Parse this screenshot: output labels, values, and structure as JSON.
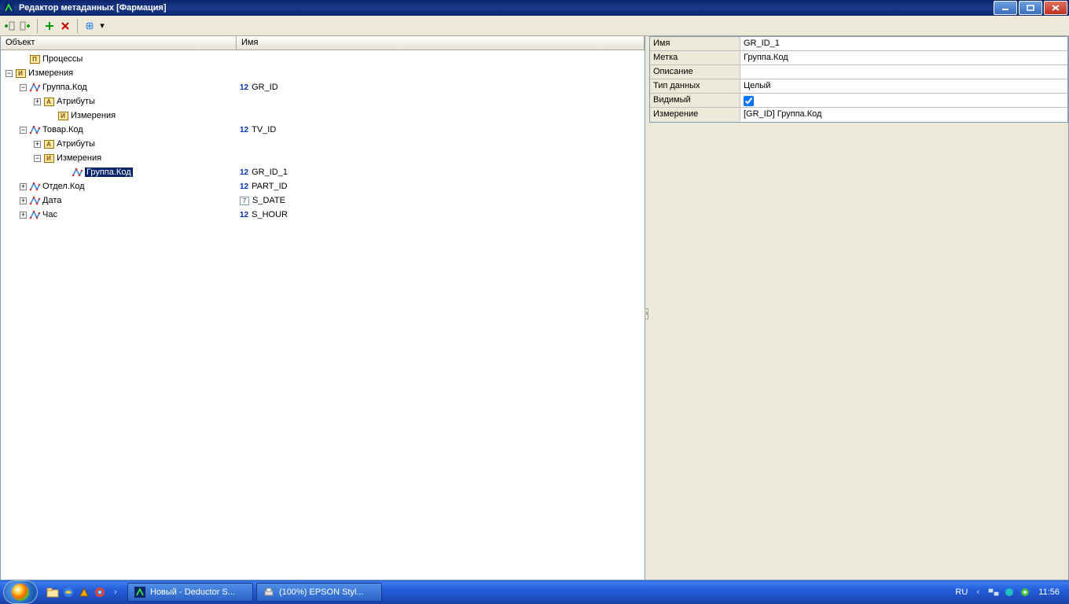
{
  "window": {
    "title": "Редактор метаданных [Фармация]"
  },
  "columns": {
    "object": "Объект",
    "name": "Имя"
  },
  "tree": [
    {
      "indent": 1,
      "expander": "none",
      "iconType": "box-p",
      "label": "Процессы",
      "name": "",
      "nameIcon": ""
    },
    {
      "indent": 0,
      "expander": "minus",
      "iconType": "box-i",
      "label": "Измерения",
      "name": "",
      "nameIcon": ""
    },
    {
      "indent": 1,
      "expander": "minus",
      "iconType": "dim",
      "label": "Группа.Код",
      "name": "GR_ID",
      "nameIcon": "12"
    },
    {
      "indent": 2,
      "expander": "plus",
      "iconType": "box-a",
      "label": "Атрибуты",
      "name": "",
      "nameIcon": ""
    },
    {
      "indent": 3,
      "expander": "none",
      "iconType": "box-i",
      "label": "Измерения",
      "name": "",
      "nameIcon": ""
    },
    {
      "indent": 1,
      "expander": "minus",
      "iconType": "dim",
      "label": "Товар.Код",
      "name": "TV_ID",
      "nameIcon": "12"
    },
    {
      "indent": 2,
      "expander": "plus",
      "iconType": "box-a",
      "label": "Атрибуты",
      "name": "",
      "nameIcon": ""
    },
    {
      "indent": 2,
      "expander": "minus",
      "iconType": "box-i",
      "label": "Измерения",
      "name": "",
      "nameIcon": ""
    },
    {
      "indent": 4,
      "expander": "none",
      "iconType": "dim",
      "label": "Группа.Код",
      "name": "GR_ID_1",
      "nameIcon": "12",
      "selected": true
    },
    {
      "indent": 1,
      "expander": "plus",
      "iconType": "dim",
      "label": "Отдел.Код",
      "name": "PART_ID",
      "nameIcon": "12"
    },
    {
      "indent": 1,
      "expander": "plus",
      "iconType": "dim",
      "label": "Дата",
      "name": "S_DATE",
      "nameIcon": "cal"
    },
    {
      "indent": 1,
      "expander": "plus",
      "iconType": "dim",
      "label": "Час",
      "name": "S_HOUR",
      "nameIcon": "12"
    }
  ],
  "props": {
    "name_label": "Имя",
    "name_value": "GR_ID_1",
    "label_label": "Метка",
    "label_value": "Группа.Код",
    "desc_label": "Описание",
    "desc_value": "",
    "type_label": "Тип данных",
    "type_value": "Целый",
    "visible_label": "Видимый",
    "visible_checked": true,
    "dim_label": "Измерение",
    "dim_value": "[GR_ID] Группа.Код"
  },
  "taskbar": {
    "task1": "Новый - Deductor S...",
    "task2": "(100%) EPSON Styl...",
    "lang": "RU",
    "clock": "11:56"
  }
}
